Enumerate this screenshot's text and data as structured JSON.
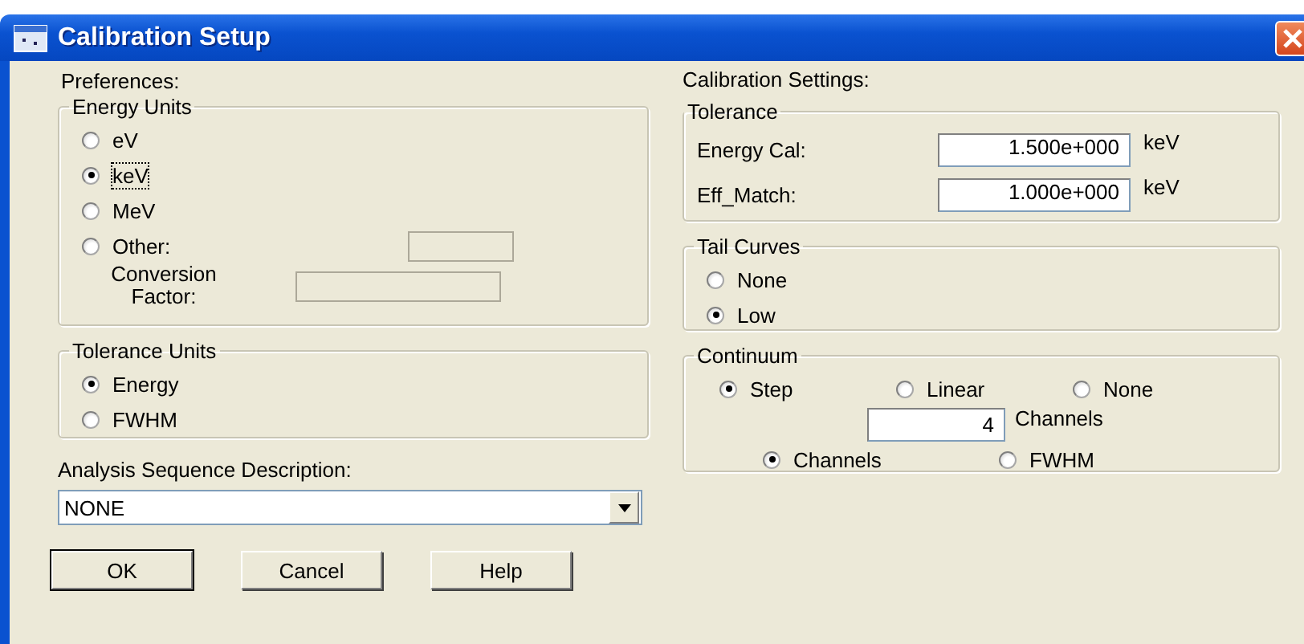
{
  "window": {
    "title": "Calibration Setup"
  },
  "preferences": {
    "label": "Preferences:",
    "energy_units": {
      "title": "Energy Units",
      "options": [
        {
          "label": "eV",
          "selected": false,
          "focused": false
        },
        {
          "label": "keV",
          "selected": true,
          "focused": true
        },
        {
          "label": "MeV",
          "selected": false,
          "focused": false
        },
        {
          "label": "Other:",
          "selected": false,
          "focused": false
        }
      ],
      "other_field": {
        "disabled": true
      },
      "conversion_factor": {
        "label": "Conversion Factor:",
        "disabled": true
      }
    },
    "tolerance_units": {
      "title": "Tolerance Units",
      "options": [
        {
          "label": "Energy",
          "selected": true
        },
        {
          "label": "FWHM",
          "selected": false
        }
      ]
    },
    "analysis_sequence": {
      "label": "Analysis Sequence Description:",
      "value": "NONE"
    }
  },
  "buttons": [
    {
      "label": "OK",
      "default": true
    },
    {
      "label": "Cancel",
      "default": false
    },
    {
      "label": "Help",
      "default": false
    }
  ],
  "calibration_settings": {
    "label": "Calibration Settings:",
    "tolerance": {
      "title": "Tolerance",
      "fields": [
        {
          "label": "Energy Cal:",
          "value": "1.500e+000",
          "unit": "keV"
        },
        {
          "label": "Eff_Match:",
          "value": "1.000e+000",
          "unit": "keV"
        }
      ]
    },
    "tail_curves": {
      "title": "Tail Curves",
      "options": [
        {
          "label": "None",
          "selected": false
        },
        {
          "label": "Low",
          "selected": true
        }
      ]
    },
    "continuum": {
      "title": "Continuum",
      "shape_options": [
        {
          "label": "Step",
          "selected": true
        },
        {
          "label": "Linear",
          "selected": false
        },
        {
          "label": "None",
          "selected": false
        }
      ],
      "channels_field": {
        "value": "4",
        "unit": "Channels"
      },
      "width_options": [
        {
          "label": "Channels",
          "selected": true
        },
        {
          "label": "FWHM",
          "selected": false
        }
      ]
    }
  }
}
